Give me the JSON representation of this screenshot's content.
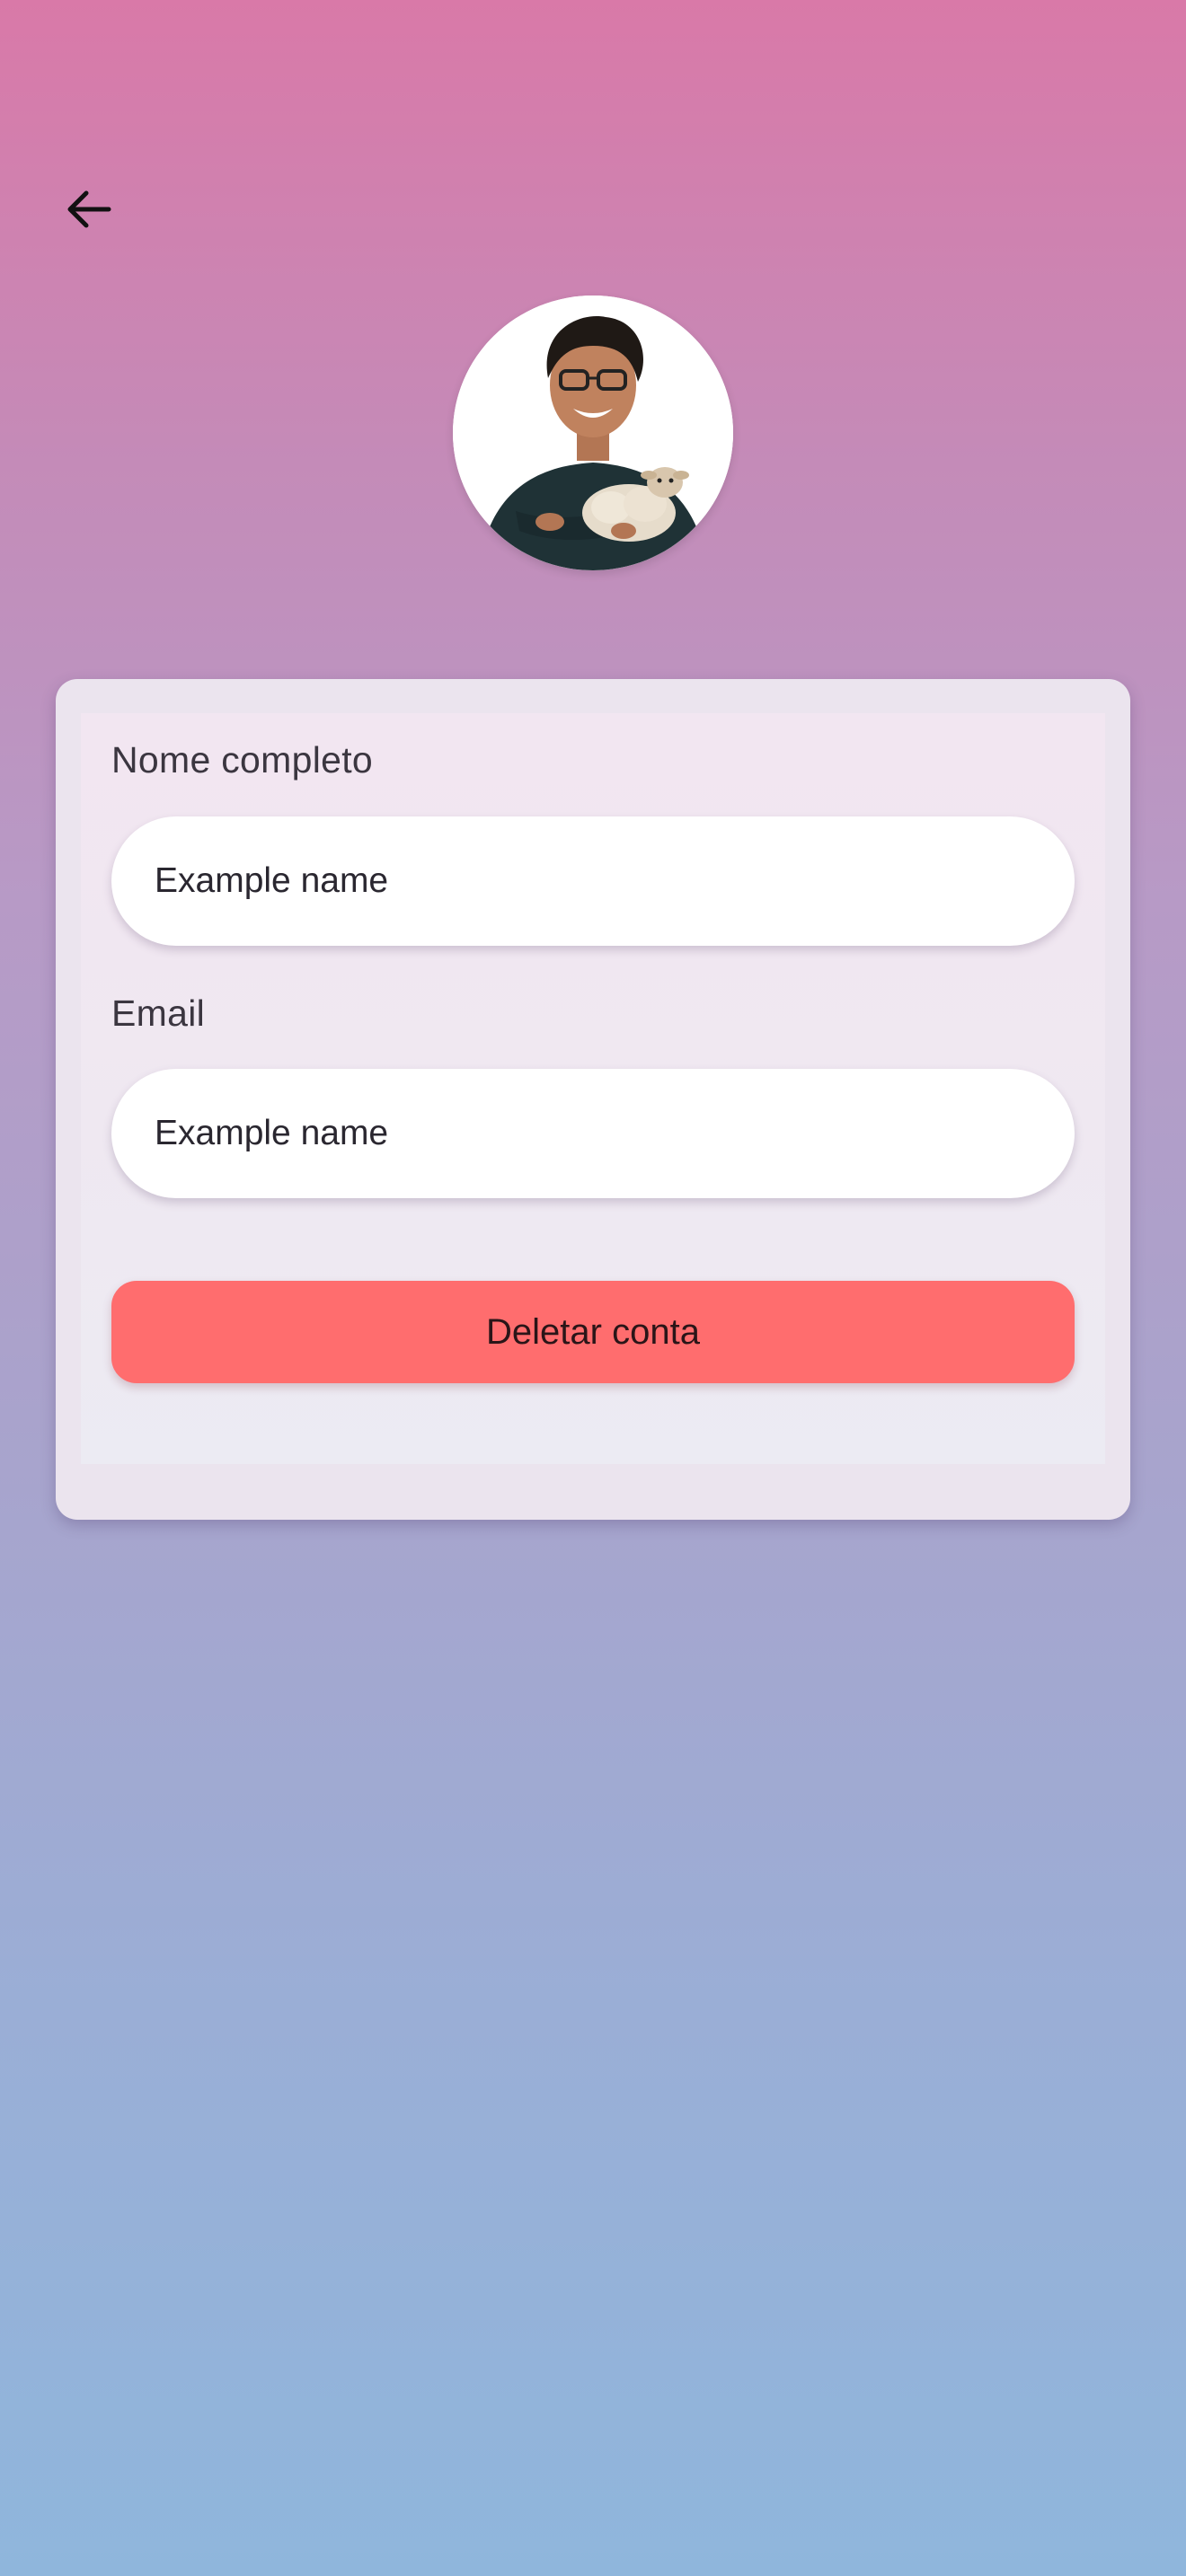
{
  "header": {
    "back_icon": "arrow-left-icon"
  },
  "profile": {
    "avatar_icon": "avatar-photo"
  },
  "form": {
    "name_label": "Nome completo",
    "name_value": "Example name",
    "email_label": "Email",
    "email_value": "Example name",
    "delete_label": "Deletar conta"
  },
  "colors": {
    "background_top": "#d979a8",
    "background_bottom": "#8fb6dc",
    "card": "#ebe4ee",
    "delete_button": "#ff6d6e",
    "input": "#ffffff"
  }
}
